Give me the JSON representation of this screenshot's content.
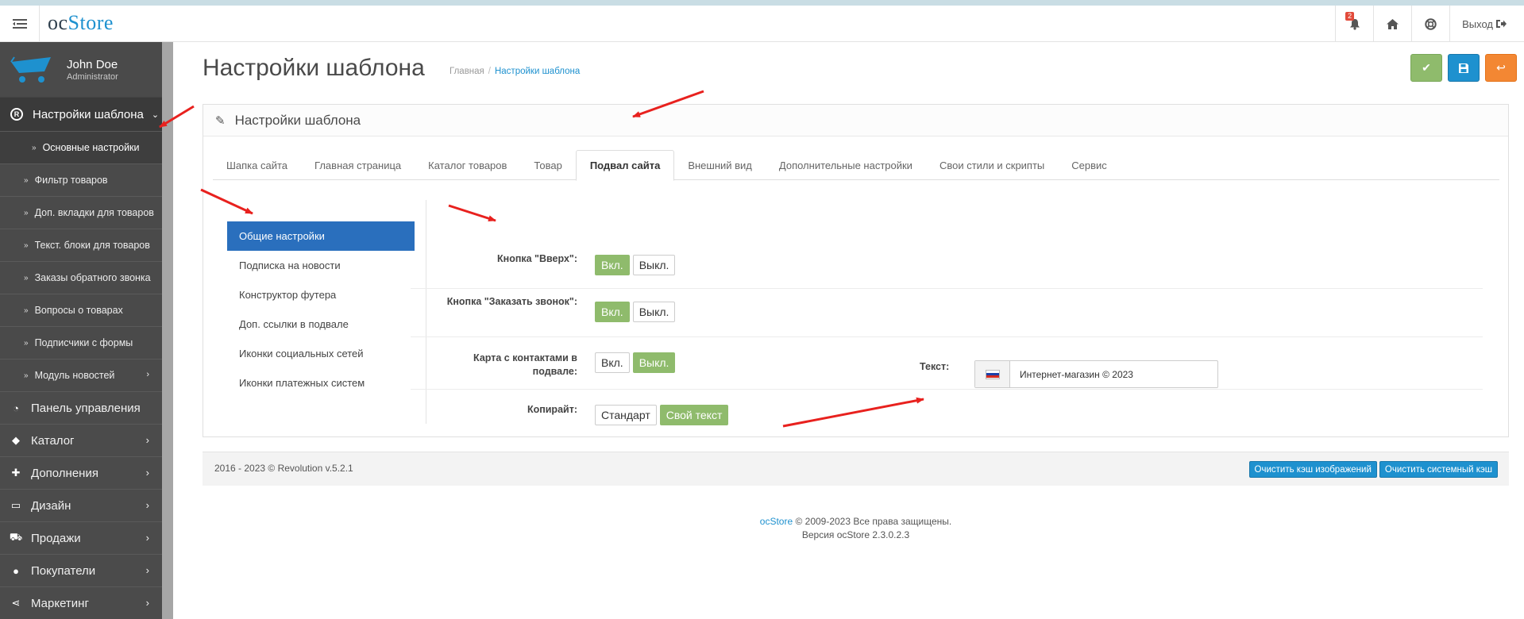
{
  "header": {
    "logo_a": "oc",
    "logo_b": "Store",
    "notif_count": "2",
    "logout_label": "Выход"
  },
  "user": {
    "name": "John Doe",
    "role": "Administrator"
  },
  "sidebar": {
    "open_section": "Настройки шаблона",
    "sub_items": [
      "Основные настройки",
      "Фильтр товаров",
      "Доп. вкладки для товаров",
      "Текст. блоки для товаров",
      "Заказы обратного звонка",
      "Вопросы о товарах",
      "Подписчики с формы",
      "Модуль новостей"
    ],
    "items": [
      {
        "label": "Панель управления",
        "icon": "dashboard-icon"
      },
      {
        "label": "Каталог",
        "icon": "tags-icon"
      },
      {
        "label": "Дополнения",
        "icon": "puzzle-icon"
      },
      {
        "label": "Дизайн",
        "icon": "monitor-icon"
      },
      {
        "label": "Продажи",
        "icon": "cart-icon"
      },
      {
        "label": "Покупатели",
        "icon": "user-icon"
      },
      {
        "label": "Маркетинг",
        "icon": "share-icon"
      }
    ]
  },
  "page": {
    "title": "Настройки шаблона",
    "breadcrumb": [
      "Главная",
      "Настройки шаблона"
    ]
  },
  "panel": {
    "title": "Настройки шаблона",
    "tabs": [
      "Шапка сайта",
      "Главная страница",
      "Каталог товаров",
      "Товар",
      "Подвал сайта",
      "Внешний вид",
      "Дополнительные настройки",
      "Свои стили и скрипты",
      "Сервис"
    ],
    "active_tab": "Подвал сайта",
    "vnav": [
      "Общие настройки",
      "Подписка на новости",
      "Конструктор футера",
      "Доп. ссылки в подвале",
      "Иконки социальных сетей",
      "Иконки платежных систем"
    ],
    "rows": [
      {
        "label": "Кнопка \"Вверх\":",
        "on": "Вкл.",
        "off": "Выкл.",
        "active": "on"
      },
      {
        "label": "Кнопка \"Заказать звонок\":",
        "on": "Вкл.",
        "off": "Выкл.",
        "active": "on"
      },
      {
        "label": "Карта с контактами в подвале:",
        "on": "Вкл.",
        "off": "Выкл.",
        "active": "off"
      }
    ],
    "copyright": {
      "label": "Копирайт:",
      "opt1": "Стандарт",
      "opt2": "Свой текст",
      "text_label": "Текст:",
      "text_value": "Интернет-магазин © 2023"
    }
  },
  "footer": {
    "version": "2016 - 2023 © Revolution v.5.2.1",
    "btn_images": "Очистить кэш изображений",
    "btn_system": "Очистить системный кэш",
    "brand": "ocStore",
    "rights": "© 2009-2023 Все права защищены.",
    "store_version": "Версия ocStore 2.3.0.2.3"
  },
  "colors": {
    "accent": "#1e91cf",
    "success": "#8fbb6c",
    "warning": "#f38733",
    "annotation": "#e8211e"
  }
}
